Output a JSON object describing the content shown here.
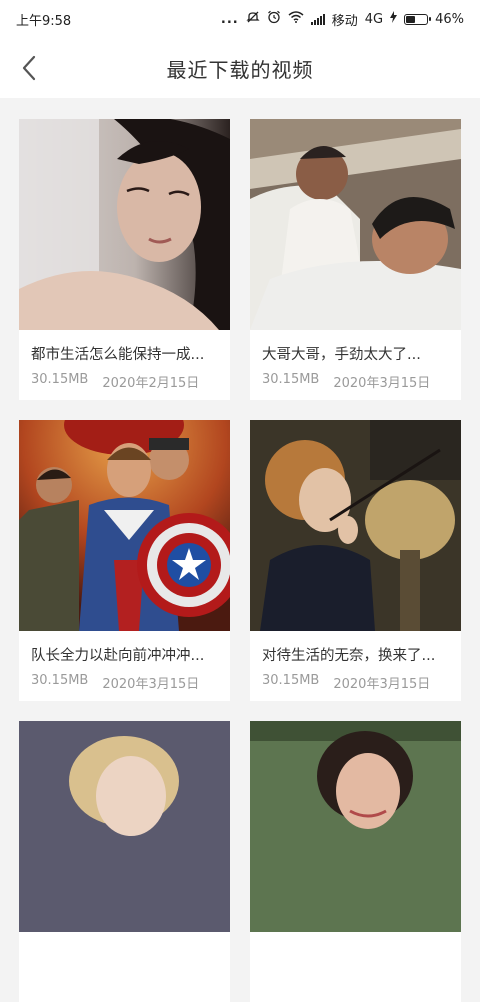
{
  "statusbar": {
    "time": "上午9:58",
    "dots": "...",
    "carrier": "移动",
    "network": "4G",
    "battery": "46%",
    "battery_level": 0.46
  },
  "header": {
    "title": "最近下载的视频"
  },
  "videos": [
    {
      "title": "都市生活怎么能保持一成...",
      "size": "30.15MB",
      "date": "2020年2月15日",
      "thumb": "woman-pillow"
    },
    {
      "title": "大哥大哥，手劲太大了...",
      "size": "30.15MB",
      "date": "2020年3月15日",
      "thumb": "men-bed"
    },
    {
      "title": "队长全力以赴向前冲冲冲...",
      "size": "30.15MB",
      "date": "2020年3月15日",
      "thumb": "captain-america"
    },
    {
      "title": "对待生活的无奈，换来了...",
      "size": "30.15MB",
      "date": "2020年3月15日",
      "thumb": "woman-wand"
    },
    {
      "title": "",
      "size": "",
      "date": "",
      "thumb": "blonde-woman"
    },
    {
      "title": "",
      "size": "",
      "date": "",
      "thumb": "smiling-woman"
    }
  ],
  "icons": {
    "back": "chevron-left-icon"
  }
}
